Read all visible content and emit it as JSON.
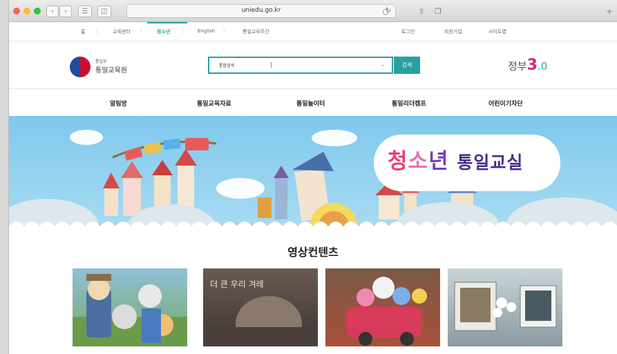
{
  "browser": {
    "url": "uniedu.go.kr",
    "back_icon": "chevron-left-icon",
    "forward_icon": "chevron-right-icon"
  },
  "top_links": {
    "home": "홈",
    "training_center": "교육센터",
    "youth": "청소년",
    "english": "English",
    "week": "통일교육주간",
    "login": "로그인",
    "signup": "회원가입",
    "sitemap": "사이트맵"
  },
  "header": {
    "ministry_small": "통일부",
    "ministry_name": "통일교육원",
    "search_scope": "통합검색",
    "search_divider": "|",
    "search_button": "검색",
    "gov_text": "정부",
    "gov_num": "3",
    "gov_dot": ".0"
  },
  "main_nav": [
    "알림방",
    "통일교육자료",
    "통일놀이터",
    "통일리더캠프",
    "어린이기자단"
  ],
  "banner": {
    "title_c1": "청",
    "title_c2": "소",
    "title_c3": "년",
    "title_rest": "통일교실"
  },
  "videos": {
    "section_title": "영상컨텐츠",
    "thumb_text": "더 큰 우리 겨레"
  },
  "colors": {
    "accent": "#2a9fa2",
    "banner_sky": "#7fc8ec",
    "pink": "#e83f6f",
    "purple": "#4a2a87"
  }
}
